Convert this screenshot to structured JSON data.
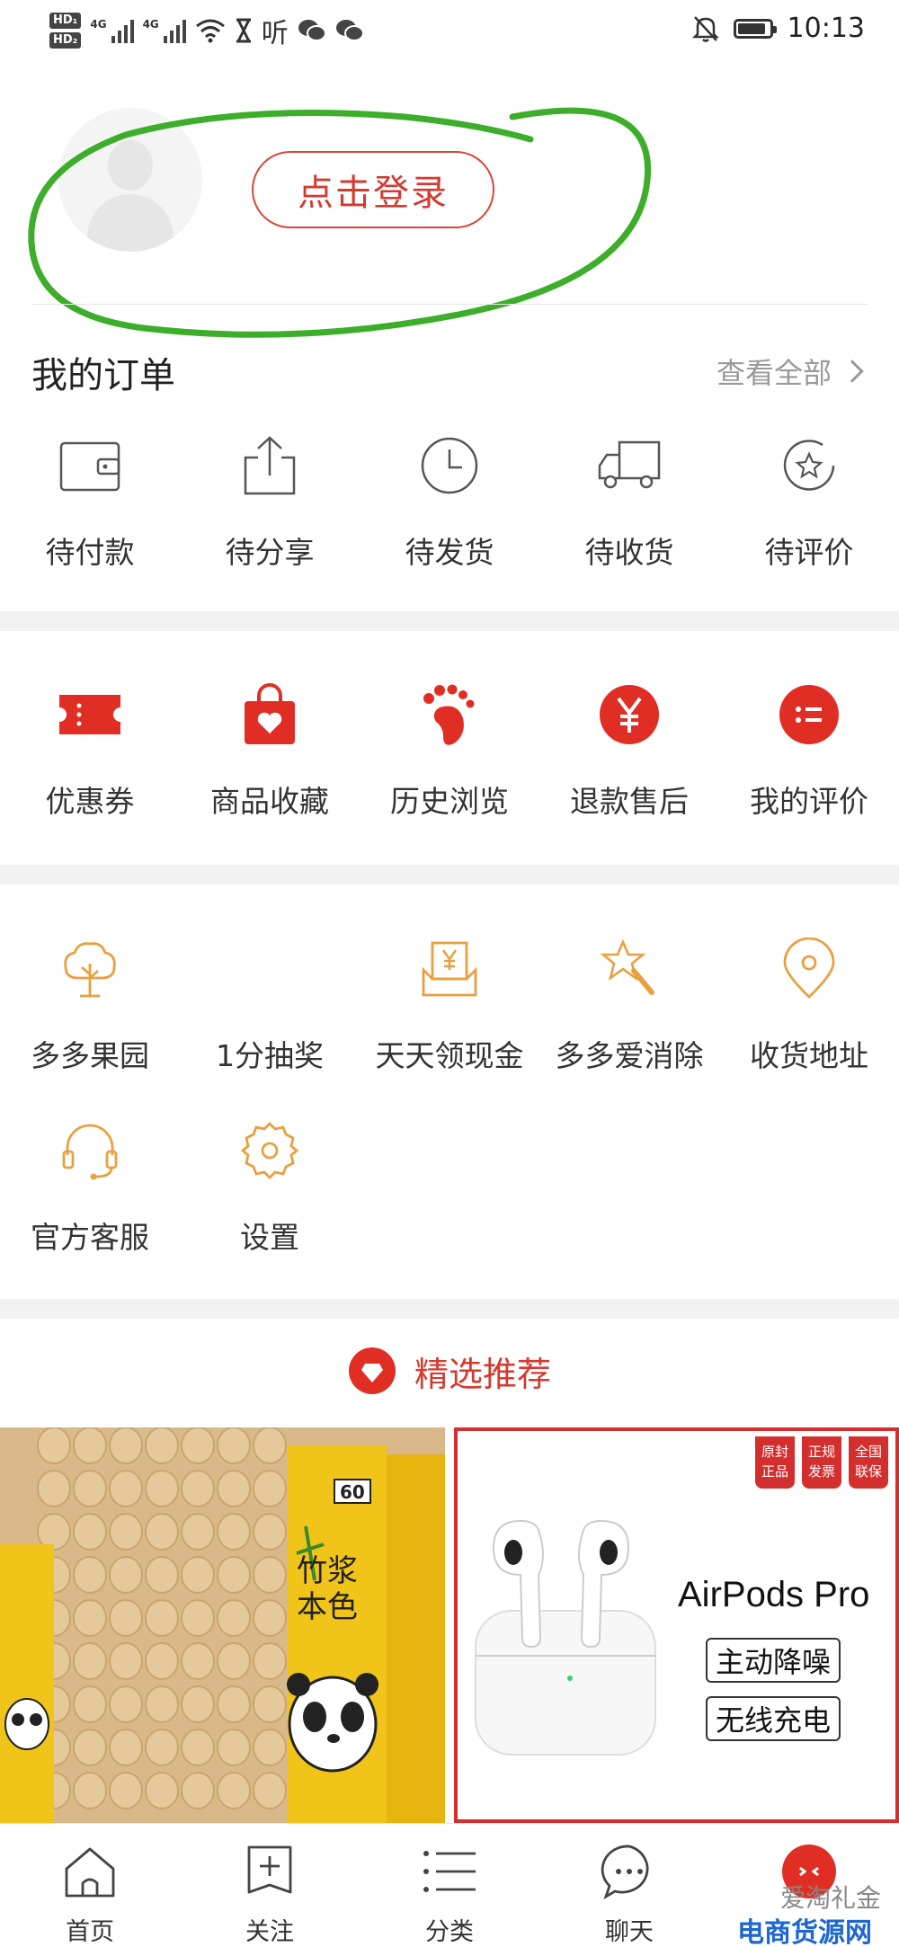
{
  "status_bar": {
    "network": "4G",
    "network2": "4G",
    "listen_text": "听",
    "time": "10:13"
  },
  "profile": {
    "login_label": "点击登录"
  },
  "orders": {
    "title": "我的订单",
    "view_all": "查看全部",
    "items": [
      {
        "label": "待付款",
        "icon": "wallet-icon"
      },
      {
        "label": "待分享",
        "icon": "share-icon"
      },
      {
        "label": "待发货",
        "icon": "clock-icon"
      },
      {
        "label": "待收货",
        "icon": "truck-icon"
      },
      {
        "label": "待评价",
        "icon": "star-review-icon"
      }
    ]
  },
  "assets": {
    "items": [
      {
        "label": "优惠券",
        "icon": "coupon-icon"
      },
      {
        "label": "商品收藏",
        "icon": "heart-bag-icon"
      },
      {
        "label": "历史浏览",
        "icon": "footprint-icon"
      },
      {
        "label": "退款售后",
        "icon": "yen-icon"
      },
      {
        "label": "我的评价",
        "icon": "comment-list-icon"
      }
    ],
    "accent": "#e02e24"
  },
  "services": {
    "items": [
      {
        "label": "多多果园",
        "icon": "tree-icon"
      },
      {
        "label": "1分抽奖",
        "icon": ""
      },
      {
        "label": "天天领现金",
        "icon": "cash-icon"
      },
      {
        "label": "多多爱消除",
        "icon": "wand-star-icon"
      },
      {
        "label": "收货地址",
        "icon": "location-icon"
      },
      {
        "label": "官方客服",
        "icon": "headset-icon"
      },
      {
        "label": "设置",
        "icon": "gear-icon"
      }
    ],
    "accent": "#e8a040"
  },
  "recommend": {
    "title": "精选推荐",
    "products": [
      {
        "brand_text": "竹浆本色",
        "count": "60"
      },
      {
        "name": "AirPods Pro",
        "tag1": "主动降噪",
        "tag2": "无线充电",
        "badges": [
          "原封正品",
          "正规发票",
          "全国联保"
        ]
      }
    ]
  },
  "tabbar": {
    "items": [
      {
        "label": "首页",
        "icon": "home-icon"
      },
      {
        "label": "关注",
        "icon": "plus-box-icon"
      },
      {
        "label": "分类",
        "icon": "list-icon"
      },
      {
        "label": "聊天",
        "icon": "chat-icon"
      },
      {
        "label": "",
        "icon": "profile-icon"
      }
    ]
  },
  "watermark": {
    "line1": "爱淘礼金",
    "line2": "电商货源网"
  }
}
